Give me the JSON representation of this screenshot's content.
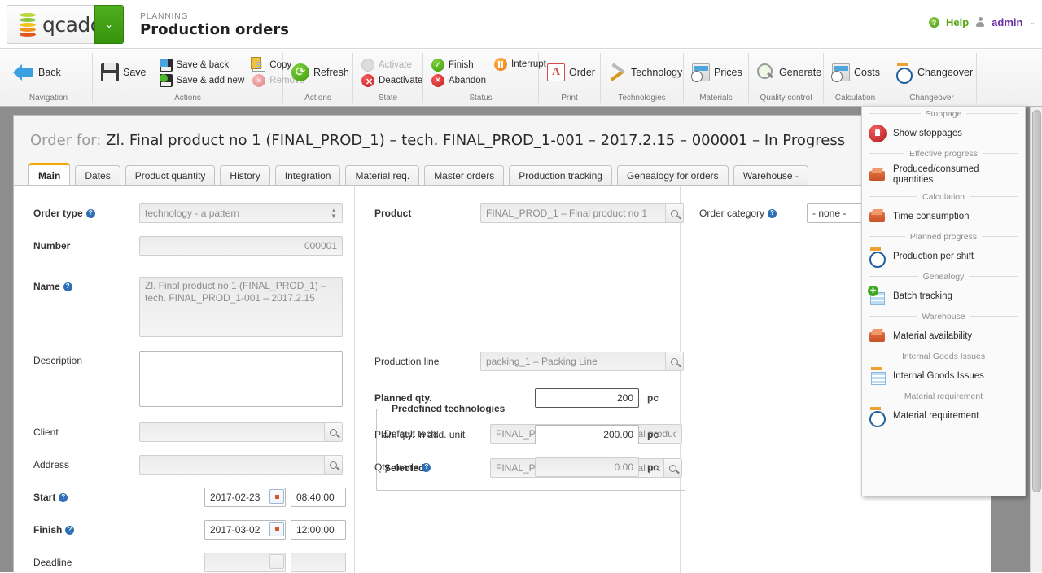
{
  "header": {
    "logo_text": "qcadoo",
    "logo_caret": "⌄",
    "module_label": "PLANNING",
    "page_title": "Production orders",
    "help_label": "Help",
    "help_icon_char": "?",
    "user_label": "admin",
    "user_caret": "⌄"
  },
  "ribbon": {
    "groups": [
      {
        "title": "Navigation",
        "items": [
          {
            "label": "Back",
            "icon": "back-arrow-icon",
            "disabled": false
          }
        ]
      },
      {
        "title": "Actions",
        "items": [
          {
            "label": "Save",
            "icon": "floppy-disk-icon",
            "disabled": false
          },
          {
            "label": "Save & back",
            "icon": "save-back-icon",
            "disabled": false
          },
          {
            "label": "Save & add new",
            "icon": "save-add-new-icon",
            "disabled": false
          },
          {
            "label": "Copy",
            "icon": "copy-icon",
            "disabled": false
          },
          {
            "label": "Remove",
            "icon": "remove-icon",
            "disabled": true
          }
        ]
      },
      {
        "title": "Actions",
        "items": [
          {
            "label": "Refresh",
            "icon": "refresh-icon",
            "disabled": false
          }
        ]
      },
      {
        "title": "State",
        "items": [
          {
            "label": "Activate",
            "icon": "activate-icon",
            "disabled": true
          },
          {
            "label": "Deactivate",
            "icon": "deactivate-icon",
            "disabled": false
          }
        ]
      },
      {
        "title": "Status",
        "items": [
          {
            "label": "Finish",
            "icon": "finish-check-icon",
            "disabled": false
          },
          {
            "label": "Abandon",
            "icon": "abandon-x-icon",
            "disabled": false
          },
          {
            "label": "Interrupt",
            "icon": "interrupt-pause-icon",
            "disabled": false
          }
        ]
      },
      {
        "title": "Print",
        "items": [
          {
            "label": "Order",
            "icon": "pdf-icon",
            "disabled": false
          }
        ]
      },
      {
        "title": "Technologies",
        "items": [
          {
            "label": "Technology",
            "icon": "tools-icon",
            "disabled": false
          }
        ]
      },
      {
        "title": "Materials",
        "items": [
          {
            "label": "Prices",
            "icon": "calculator-clock-icon",
            "disabled": false
          }
        ]
      },
      {
        "title": "Quality control",
        "items": [
          {
            "label": "Generate",
            "icon": "magnifier-check-icon",
            "disabled": false
          }
        ]
      },
      {
        "title": "Calculation",
        "items": [
          {
            "label": "Costs",
            "icon": "calculator-clock-icon",
            "disabled": false
          }
        ]
      },
      {
        "title": "Changeover",
        "items": [
          {
            "label": "Changeover",
            "icon": "clock-icon",
            "disabled": false
          }
        ]
      }
    ],
    "download_button_icon": "download-arrow-icon"
  },
  "order": {
    "head_prefix": "Order for:",
    "head_text": "Zl. Final product no 1 (FINAL_PROD_1) – tech. FINAL_PROD_1-001 – 2017.2.15 – 000001 – In Progress"
  },
  "tabs": [
    {
      "label": "Main",
      "active": true
    },
    {
      "label": "Dates",
      "active": false
    },
    {
      "label": "Product quantity",
      "active": false
    },
    {
      "label": "History",
      "active": false
    },
    {
      "label": "Integration",
      "active": false
    },
    {
      "label": "Material req.",
      "active": false
    },
    {
      "label": "Master orders",
      "active": false
    },
    {
      "label": "Production tracking",
      "active": false
    },
    {
      "label": "Genealogy for orders",
      "active": false
    },
    {
      "label": "Warehouse -",
      "active": false
    }
  ],
  "form": {
    "order_type": {
      "label": "Order type",
      "value": "technology - a pattern",
      "has_help": true
    },
    "number": {
      "label": "Number",
      "value": "000001",
      "has_help": false
    },
    "name": {
      "label": "Name",
      "value": "Zl. Final product no 1 (FINAL_PROD_1) – tech. FINAL_PROD_1-001 – 2017.2.15",
      "has_help": true
    },
    "description": {
      "label": "Description",
      "value": "",
      "has_help": false
    },
    "client": {
      "label": "Client",
      "value": "",
      "has_help": false
    },
    "address": {
      "label": "Address",
      "value": "",
      "has_help": false
    },
    "start": {
      "label": "Start",
      "date": "2017-02-23",
      "time": "08:40:00",
      "has_help": true
    },
    "finish": {
      "label": "Finish",
      "date": "2017-03-02",
      "time": "12:00:00",
      "has_help": true
    },
    "deadline": {
      "label": "Deadline",
      "date": "",
      "time": "",
      "has_help": false
    },
    "product": {
      "label": "Product",
      "value": "FINAL_PROD_1 – Final product no 1",
      "has_help": false
    },
    "predefined_technologies": {
      "legend": "Predefined technologies",
      "default_tech": {
        "label": "Default tech.",
        "value": "FINAL_PROD_1-001 – Tech. Final product r"
      },
      "selected": {
        "label": "Selected",
        "value": "FINAL_PROD_1-001 – Tech. Final prod"
      }
    },
    "production_line": {
      "label": "Production line",
      "value": "packing_1 – Packing Line",
      "has_help": false
    },
    "planned_qty": {
      "label": "Planned qty.",
      "value": "200",
      "unit": "pc",
      "has_help": false
    },
    "planned_qty_add_unit": {
      "label": "Plan. qty. in add. unit",
      "value": "200.00",
      "unit": "pc",
      "has_help": false
    },
    "qty_made": {
      "label": "Qty. made",
      "value": "0.00",
      "unit": "pc",
      "has_help": true
    },
    "order_category": {
      "label": "Order category",
      "value": "- none -",
      "has_help": true
    }
  },
  "menu_panel": {
    "entries": [
      {
        "kind": "separator",
        "label": "Stoppage"
      },
      {
        "kind": "item",
        "label": "Show stoppages",
        "icon": "stoppage-hand-icon"
      },
      {
        "kind": "separator",
        "label": "Effective progress"
      },
      {
        "kind": "item",
        "label": "Produced/consumed quantities",
        "icon": "box-icon"
      },
      {
        "kind": "separator",
        "label": "Calculation"
      },
      {
        "kind": "item",
        "label": "Time consumption",
        "icon": "box-icon"
      },
      {
        "kind": "separator",
        "label": "Planned progress"
      },
      {
        "kind": "item",
        "label": "Production per shift",
        "icon": "clock-icon"
      },
      {
        "kind": "separator",
        "label": "Genealogy"
      },
      {
        "kind": "item",
        "label": "Batch tracking",
        "icon": "batch-list-plus-icon"
      },
      {
        "kind": "separator",
        "label": "Warehouse"
      },
      {
        "kind": "item",
        "label": "Material availability",
        "icon": "box-icon"
      },
      {
        "kind": "separator",
        "label": "Internal Goods Issues"
      },
      {
        "kind": "item",
        "label": "Internal Goods Issues",
        "icon": "list-icon"
      },
      {
        "kind": "separator",
        "label": "Material requirement"
      },
      {
        "kind": "item",
        "label": "Material requirement",
        "icon": "clock-icon"
      }
    ]
  },
  "colors": {
    "brand_green": "#3c9a08",
    "accent_orange": "#f0a800",
    "admin_purple": "#6b2fa0",
    "help_green": "#57a40f",
    "backdrop_gray": "#8d8d8d"
  }
}
